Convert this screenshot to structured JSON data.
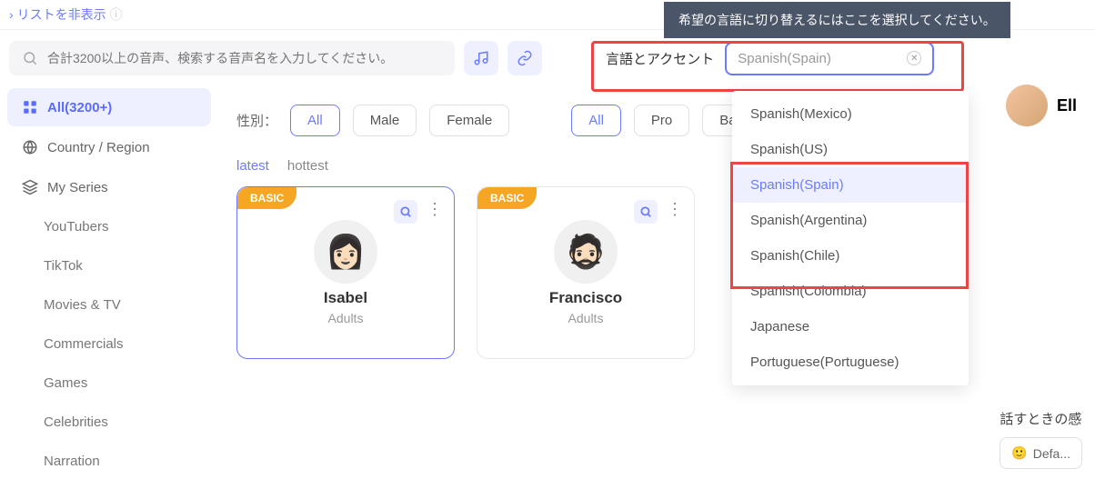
{
  "top": {
    "collapse_label": "リストを非表示",
    "tooltip": "希望の言語に切り替えるにはここを選択してください。"
  },
  "search": {
    "placeholder": "合計3200以上の音声、検索する音声名を入力してください。"
  },
  "lang": {
    "label": "言語とアクセント",
    "value": "Spanish(Spain)"
  },
  "right_user": "Ell",
  "sidebar": {
    "all": "All(3200+)",
    "country": "Country / Region",
    "myseries": "My Series",
    "subs": [
      "YouTubers",
      "TikTok",
      "Movies & TV",
      "Commercials",
      "Games",
      "Celebrities",
      "Narration"
    ]
  },
  "filters": {
    "gender_label": "性別：",
    "all": "All",
    "male": "Male",
    "female": "Female",
    "pro": "Pro",
    "basic": "Basic"
  },
  "sort": {
    "latest": "latest",
    "hottest": "hottest"
  },
  "cards": [
    {
      "badge": "BASIC",
      "name": "Isabel",
      "sub": "Adults"
    },
    {
      "badge": "BASIC",
      "name": "Francisco",
      "sub": "Adults"
    }
  ],
  "dropdown": {
    "items": [
      "Spanish(Mexico)",
      "Spanish(US)",
      "Spanish(Spain)",
      "Spanish(Argentina)",
      "Spanish(Chile)",
      "Spanish(Colombia)",
      "Japanese",
      "Portuguese(Portuguese)"
    ]
  },
  "right_panel": {
    "label": "話すときの感",
    "chip": "Defa..."
  }
}
